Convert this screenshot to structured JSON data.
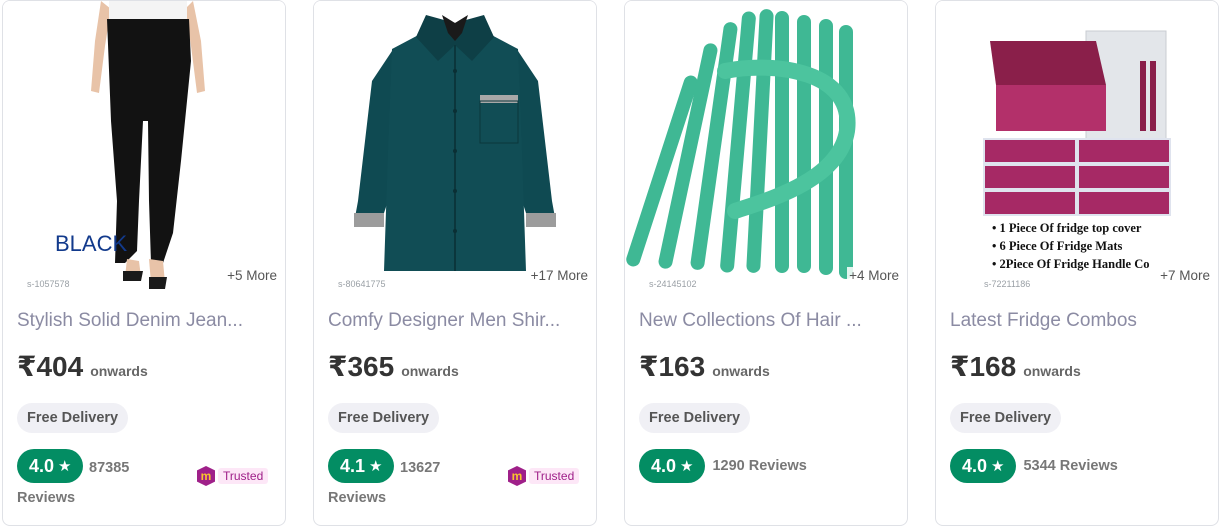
{
  "products": [
    {
      "title": "Stylish Solid Denim Jean...",
      "price": "₹404",
      "onwards": "onwards",
      "delivery": "Free Delivery",
      "rating": "4.0",
      "reviews_count": "87385",
      "reviews_label": "Reviews",
      "more": "+5 More",
      "sku": "s-1057578",
      "trusted": "Trusted",
      "image_text": "BLACK"
    },
    {
      "title": "Comfy Designer Men Shir...",
      "price": "₹365",
      "onwards": "onwards",
      "delivery": "Free Delivery",
      "rating": "4.1",
      "reviews_count": "13627",
      "reviews_label": "Reviews",
      "more": "+17 More",
      "sku": "s-80641775",
      "trusted": "Trusted"
    },
    {
      "title": "New Collections Of Hair ...",
      "price": "₹163",
      "onwards": "onwards",
      "delivery": "Free Delivery",
      "rating": "4.0",
      "reviews": "1290 Reviews",
      "more": "+4 More",
      "sku": "s-24145102"
    },
    {
      "title": "Latest Fridge Combos",
      "price": "₹168",
      "onwards": "onwards",
      "delivery": "Free Delivery",
      "rating": "4.0",
      "reviews": "5344 Reviews",
      "more": "+7 More",
      "sku": "s-72211186",
      "image_lines": [
        "1 Piece Of fridge top cover",
        "6 Piece Of Fridge Mats",
        "2Piece Of Fridge Handle Co"
      ]
    }
  ],
  "colors": {
    "rating_green": "#038d63",
    "trusted_purple": "#9f2089",
    "title_grey": "#8b8ba3"
  },
  "icons": {
    "rating": "star-icon",
    "trusted": "meesho-m-icon"
  }
}
